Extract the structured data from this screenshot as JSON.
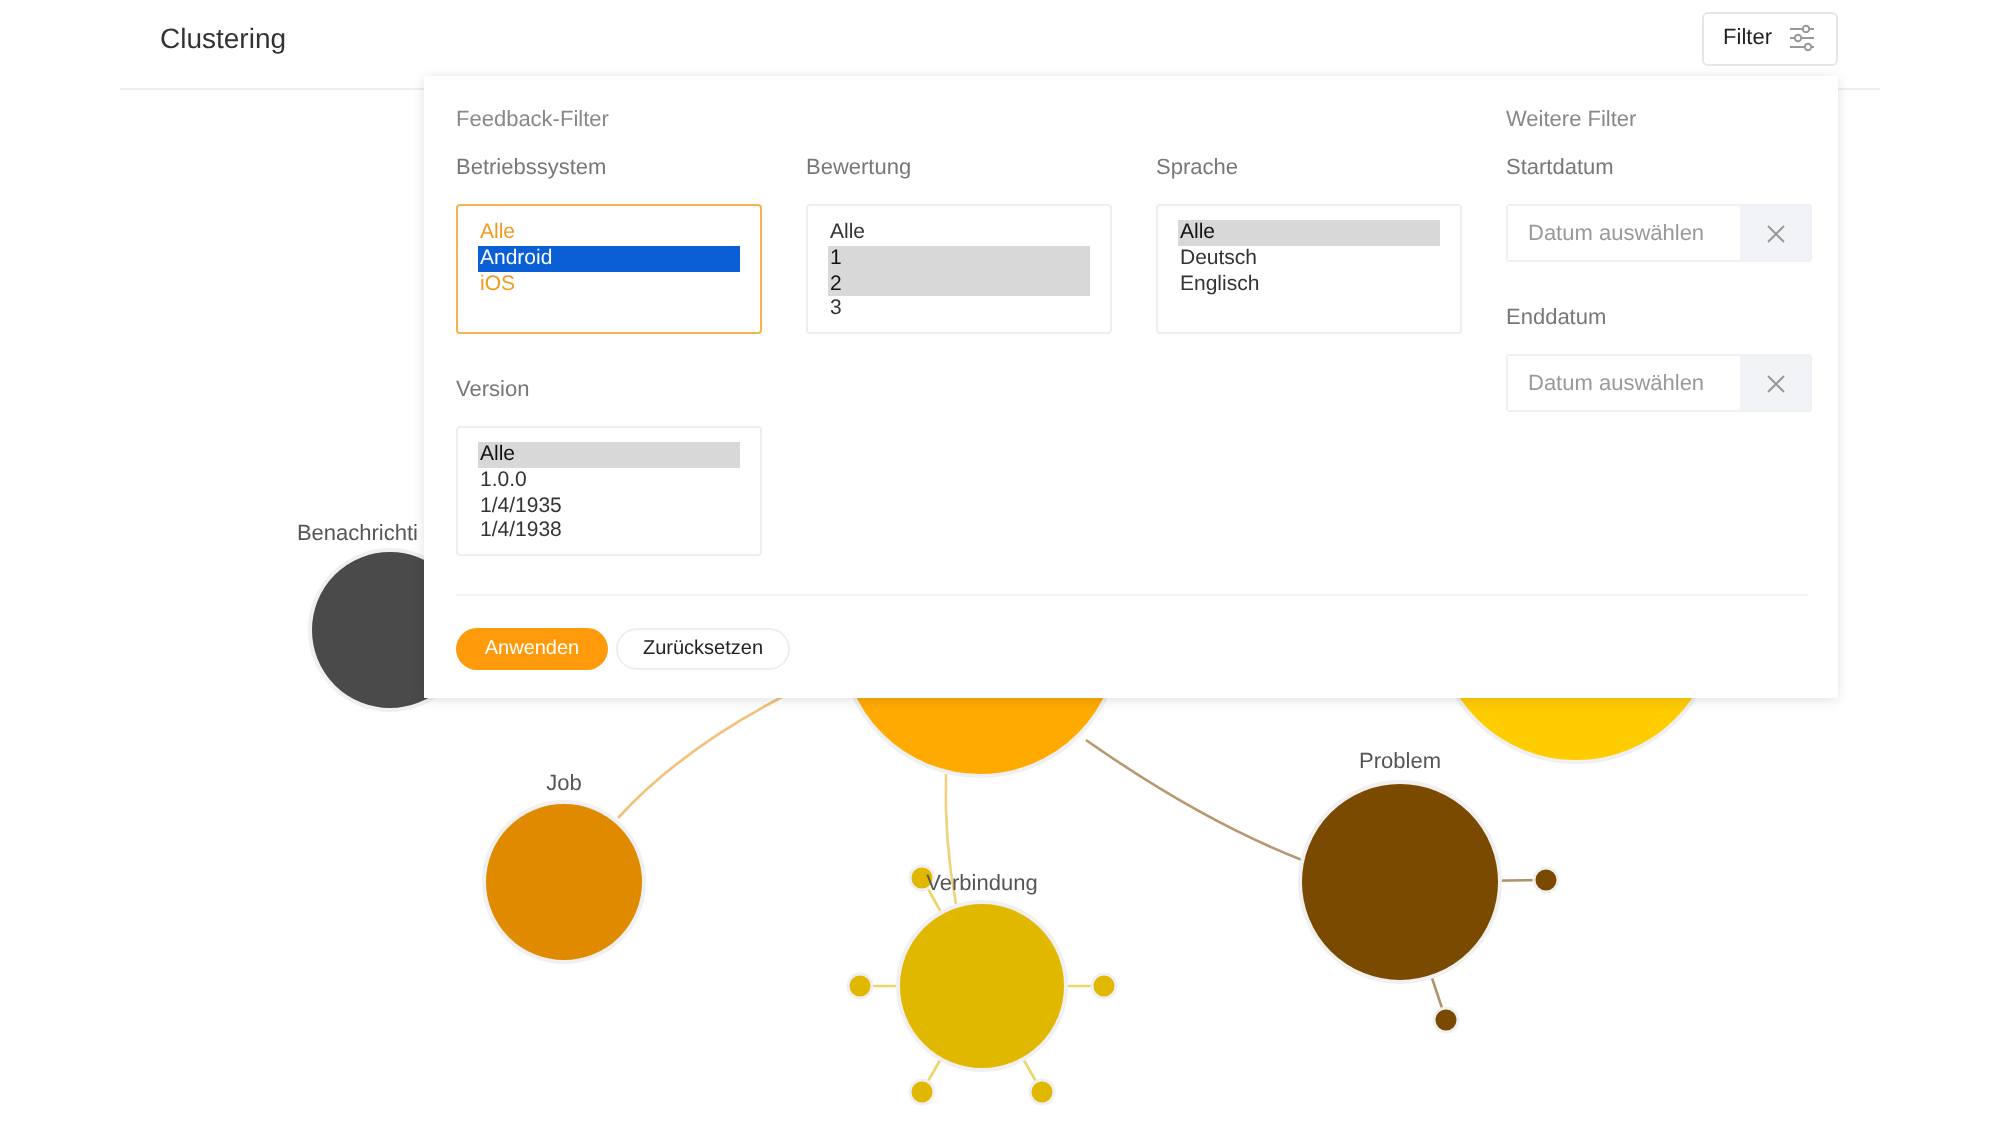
{
  "header": {
    "title": "Clustering",
    "filter_button": "Filter"
  },
  "graph": {
    "nodes": [
      {
        "label": "Benachrichti",
        "color": "#4a4a4a"
      },
      {
        "color": "#ffaa00"
      },
      {
        "color": "#ffcc00"
      },
      {
        "label": "Job",
        "color": "#e08a00"
      },
      {
        "label": "Verbindung",
        "color": "#e0b800"
      },
      {
        "label": "Problem",
        "color": "#7a4a00"
      }
    ]
  },
  "filter_panel": {
    "title": "Feedback-Filter",
    "lists": [
      {
        "label": "Betriebssystem",
        "focused": true,
        "options": [
          {
            "text": "Alle",
            "selected": false
          },
          {
            "text": "Android",
            "selected": true
          },
          {
            "text": "iOS",
            "selected": false
          }
        ]
      },
      {
        "label": "Bewertung",
        "focused": false,
        "options": [
          {
            "text": "Alle",
            "selected": false
          },
          {
            "text": "1",
            "selected": true
          },
          {
            "text": "2",
            "selected": true
          },
          {
            "text": "3",
            "selected": false
          }
        ]
      },
      {
        "label": "Sprache",
        "focused": false,
        "options": [
          {
            "text": "Alle",
            "selected": true
          },
          {
            "text": "Deutsch",
            "selected": false
          },
          {
            "text": "Englisch",
            "selected": false
          }
        ]
      },
      {
        "label": "Version",
        "focused": false,
        "options": [
          {
            "text": "Alle",
            "selected": true
          },
          {
            "text": "1.0.0",
            "selected": false
          },
          {
            "text": "1/4/1935",
            "selected": false
          },
          {
            "text": "1/4/1938",
            "selected": false
          }
        ]
      }
    ],
    "more_title": "Weitere Filter",
    "date_fields": [
      {
        "label": "Startdatum",
        "placeholder": "Datum auswählen"
      },
      {
        "label": "Enddatum",
        "placeholder": "Datum auswählen"
      }
    ],
    "apply_button": "Anwenden",
    "reset_button": "Zurücksetzen"
  }
}
